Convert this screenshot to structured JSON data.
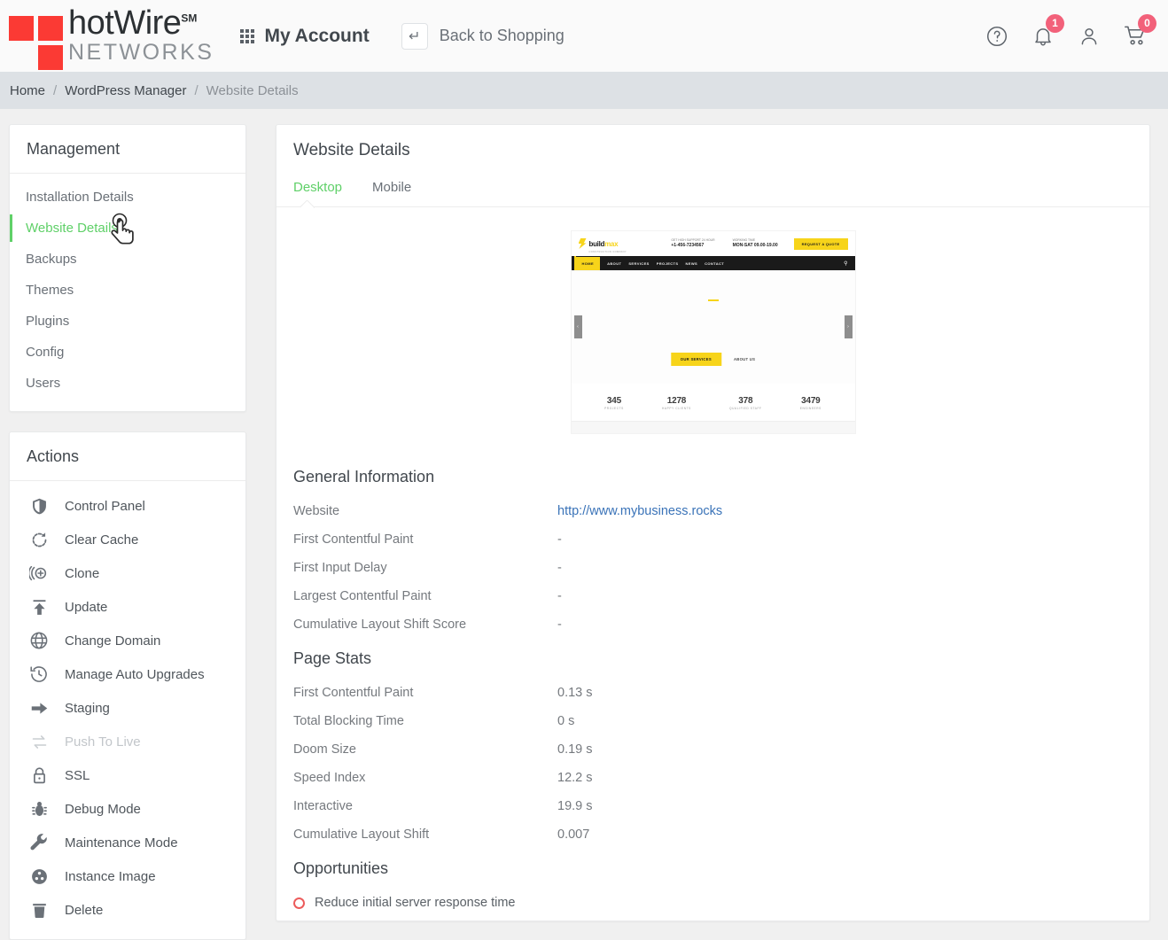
{
  "header": {
    "logo": {
      "name_top": "hotWire",
      "sm": "SM",
      "name_bottom": "NETWORKS"
    },
    "my_account_label": "My Account",
    "back_to_shopping_label": "Back to Shopping",
    "icons": {
      "help": "help-circle-icon",
      "bell": "bell-icon",
      "user": "user-icon",
      "cart": "cart-icon"
    },
    "notification_count": "1",
    "cart_count": "0",
    "badge_color": "#f2617a"
  },
  "breadcrumb": {
    "items": [
      {
        "label": "Home",
        "current": false
      },
      {
        "label": "WordPress Manager",
        "current": false
      },
      {
        "label": "Website Details",
        "current": true
      }
    ],
    "separator": "/"
  },
  "sidebar": {
    "management": {
      "title": "Management",
      "items": [
        {
          "label": "Installation Details",
          "active": false
        },
        {
          "label": "Website Details",
          "active": true
        },
        {
          "label": "Backups",
          "active": false
        },
        {
          "label": "Themes",
          "active": false
        },
        {
          "label": "Plugins",
          "active": false
        },
        {
          "label": "Config",
          "active": false
        },
        {
          "label": "Users",
          "active": false
        }
      ],
      "active_color": "#5fd068"
    },
    "actions": {
      "title": "Actions",
      "items": [
        {
          "label": "Control Panel",
          "icon": "shield-icon",
          "disabled": false
        },
        {
          "label": "Clear Cache",
          "icon": "refresh-icon",
          "disabled": false
        },
        {
          "label": "Clone",
          "icon": "clone-plus-icon",
          "disabled": false
        },
        {
          "label": "Update",
          "icon": "upload-arrow-icon",
          "disabled": false
        },
        {
          "label": "Change Domain",
          "icon": "globe-icon",
          "disabled": false
        },
        {
          "label": "Manage Auto Upgrades",
          "icon": "history-clock-icon",
          "disabled": false
        },
        {
          "label": "Staging",
          "icon": "arrow-right-icon",
          "disabled": false
        },
        {
          "label": "Push To Live",
          "icon": "swap-icon",
          "disabled": true
        },
        {
          "label": "SSL",
          "icon": "lock-icon",
          "disabled": false
        },
        {
          "label": "Debug Mode",
          "icon": "bug-icon",
          "disabled": false
        },
        {
          "label": "Maintenance Mode",
          "icon": "wrench-icon",
          "disabled": false
        },
        {
          "label": "Instance Image",
          "icon": "film-reel-icon",
          "disabled": false
        },
        {
          "label": "Delete",
          "icon": "trash-icon",
          "disabled": false
        }
      ]
    }
  },
  "main": {
    "title": "Website Details",
    "tabs": [
      {
        "label": "Desktop",
        "active": true
      },
      {
        "label": "Mobile",
        "active": false
      }
    ],
    "preview": {
      "brand": "build",
      "brand_accent": "max",
      "brand_sub": "CONSTRUCTION COMPANY",
      "support_label": "GET HIGH SUPPORT 24 HOUR",
      "support_value": "+1-456-7234567",
      "hours_label": "WORKING TIME",
      "hours_value": "MON-SAT 09.00-19.00",
      "quote_button": "REQUEST A QUOTE",
      "nav": [
        "HOME",
        "ABOUT",
        "SERVICES",
        "PROJECTS",
        "NEWS",
        "CONTACT"
      ],
      "cta_button": "OUR SERVICES",
      "cta_link": "ABOUT US",
      "stats": [
        {
          "value": "345",
          "label": "PROJECTS"
        },
        {
          "value": "1278",
          "label": "HAPPY CLIENTS"
        },
        {
          "value": "378",
          "label": "QUALIFIED STAFF"
        },
        {
          "value": "3479",
          "label": "ENGINEERS"
        }
      ]
    },
    "general_information": {
      "title": "General Information",
      "rows": [
        {
          "key": "Website",
          "value": "http://www.mybusiness.rocks",
          "is_link": true
        },
        {
          "key": "First Contentful Paint",
          "value": "-",
          "is_link": false
        },
        {
          "key": "First Input Delay",
          "value": "-",
          "is_link": false
        },
        {
          "key": "Largest Contentful Paint",
          "value": "-",
          "is_link": false
        },
        {
          "key": "Cumulative Layout Shift Score",
          "value": "-",
          "is_link": false
        }
      ]
    },
    "page_stats": {
      "title": "Page Stats",
      "rows": [
        {
          "key": "First Contentful Paint",
          "value": "0.13 s"
        },
        {
          "key": "Total Blocking Time",
          "value": "0 s"
        },
        {
          "key": "Doom Size",
          "value": "0.19 s"
        },
        {
          "key": "Speed Index",
          "value": "12.2 s"
        },
        {
          "key": "Interactive",
          "value": "19.9 s"
        },
        {
          "key": "Cumulative Layout Shift",
          "value": "0.007"
        }
      ]
    },
    "opportunities": {
      "title": "Opportunities",
      "items": [
        {
          "label": "Reduce initial server response time",
          "severity_color": "#ec5b5b"
        }
      ]
    }
  }
}
